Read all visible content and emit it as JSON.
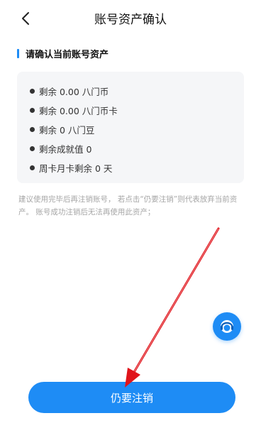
{
  "header": {
    "title": "账号资产确认",
    "back_icon": "chevron-left-icon"
  },
  "section": {
    "heading": "请确认当前账号资产"
  },
  "assets": {
    "items": [
      {
        "text": "剩余 0.00 八门币"
      },
      {
        "text": "剩余 0.00 八门币卡"
      },
      {
        "text": "剩余 0 八门豆"
      },
      {
        "text": "剩余成就值 0"
      },
      {
        "text": "周卡月卡剩余 0 天"
      }
    ]
  },
  "notice": {
    "text": "建议使用完毕后再注销账号， 若点击“仍要注销”则代表放弃当前资产。 账号成功注销后无法再使用此资产；"
  },
  "customer_service": {
    "icon": "customer-service-icon"
  },
  "confirm": {
    "label": "仍要注销"
  },
  "colors": {
    "accent": "#1e8cf5",
    "annotation_arrow": "#e0141b"
  }
}
